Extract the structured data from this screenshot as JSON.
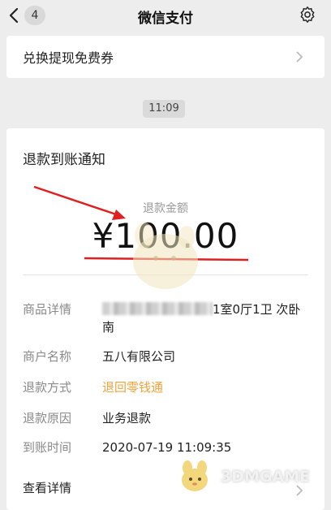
{
  "header": {
    "title": "微信支付",
    "unread_count": "4"
  },
  "redeem_card": {
    "label": "兑换提现免费券"
  },
  "timestamp": "11:09",
  "notice": {
    "title": "退款到账通知",
    "amount_label": "退款金额",
    "amount": "¥100.00",
    "rows": [
      {
        "key": "商品详情",
        "value": "1室0厅1卫 次卧南"
      },
      {
        "key": "商户名称",
        "value": "五八有限公司"
      },
      {
        "key": "退款方式",
        "value": "退回零钱通"
      },
      {
        "key": "退款原因",
        "value": "业务退款"
      },
      {
        "key": "到账时间",
        "value": "2020-07-19 11:09:35"
      }
    ],
    "view_details": "查看详情"
  },
  "watermark": {
    "text": "3DMGAME"
  },
  "colors": {
    "background": "#ededed",
    "accent_orange": "#f0a43b",
    "annotation_red": "#e02020"
  }
}
